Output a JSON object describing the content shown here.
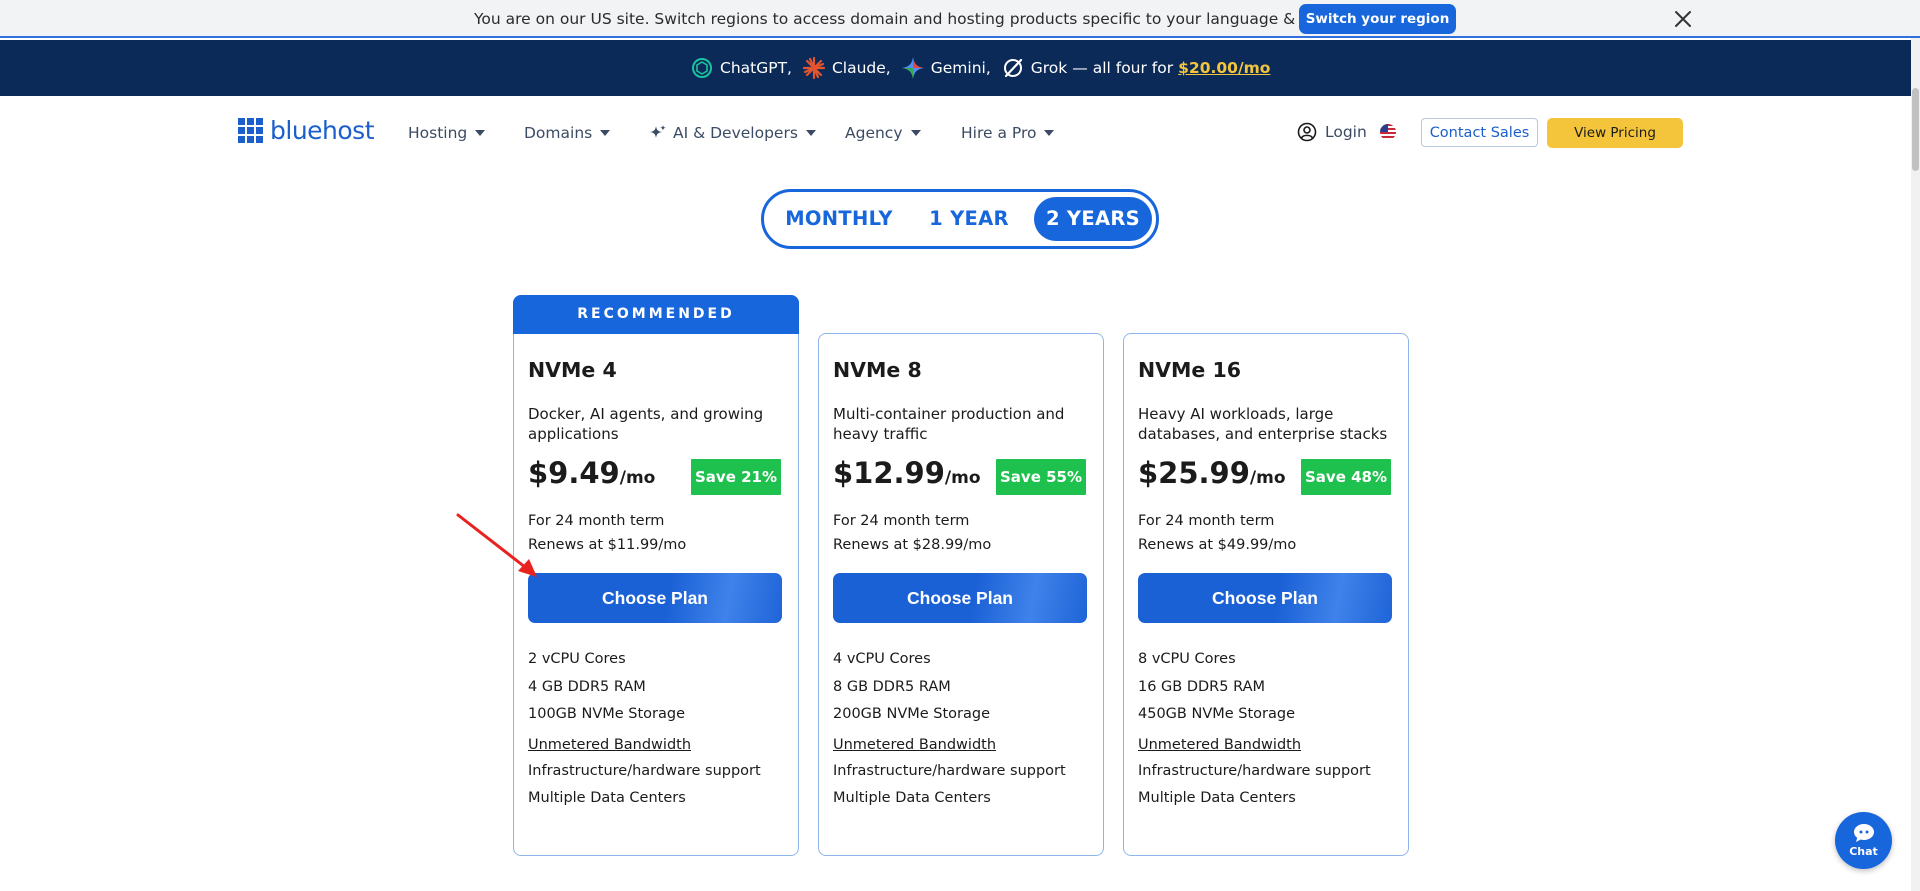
{
  "region_bar": {
    "message": "You are on our US site. Switch regions to access domain and hosting products specific to your language & currency.",
    "switch_button": "Switch your region",
    "close_icon": "close-icon"
  },
  "promo": {
    "items": [
      "ChatGPT,",
      "Claude,",
      "Gemini,",
      "Grok"
    ],
    "suffix": "— all four for",
    "price": "$20.00/mo",
    "icons": [
      "chatgpt-icon",
      "claude-icon",
      "gemini-icon",
      "grok-icon"
    ]
  },
  "nav": {
    "logo": "bluehost",
    "items": [
      {
        "label": "Hosting"
      },
      {
        "label": "Domains"
      },
      {
        "label": "AI & Developers"
      },
      {
        "label": "Agency"
      },
      {
        "label": "Hire a Pro"
      }
    ],
    "login": "Login",
    "contact_sales": "Contact Sales",
    "view_pricing": "View Pricing"
  },
  "term_toggle": {
    "options": [
      "MONTHLY",
      "1 YEAR",
      "2 YEARS"
    ],
    "selected": "2 YEARS"
  },
  "plans": [
    {
      "badge": "RECOMMENDED",
      "name": "NVMe 4",
      "description": "Docker, AI agents, and growing applications",
      "price": "$9.49",
      "per": "/mo",
      "save": "Save 21%",
      "term": "For 24 month term",
      "renews": "Renews at $11.99/mo",
      "cta": "Choose Plan",
      "features": [
        "2 vCPU Cores",
        "4 GB DDR5 RAM",
        "100GB NVMe Storage",
        "Unmetered Bandwidth",
        "Infrastructure/hardware support",
        "Multiple Data Centers"
      ]
    },
    {
      "name": "NVMe 8",
      "description": "Multi-container production and heavy traffic",
      "price": "$12.99",
      "per": "/mo",
      "save": "Save 55%",
      "term": "For 24 month term",
      "renews": "Renews at $28.99/mo",
      "cta": "Choose Plan",
      "features": [
        "4 vCPU Cores",
        "8 GB DDR5 RAM",
        "200GB NVMe Storage",
        "Unmetered Bandwidth",
        "Infrastructure/hardware support",
        "Multiple Data Centers"
      ]
    },
    {
      "name": "NVMe 16",
      "description": "Heavy AI workloads, large databases, and enterprise stacks",
      "price": "$25.99",
      "per": "/mo",
      "save": "Save 48%",
      "term": "For 24 month term",
      "renews": "Renews at $49.99/mo",
      "cta": "Choose Plan",
      "features": [
        "8 vCPU Cores",
        "16 GB DDR5 RAM",
        "450GB NVMe Storage",
        "Unmetered Bandwidth",
        "Infrastructure/hardware support",
        "Multiple Data Centers"
      ]
    }
  ],
  "chat": {
    "label": "Chat"
  },
  "colors": {
    "brand_blue": "#1866dc",
    "navy": "#0c2a57",
    "yellow": "#f4c53b",
    "save_green": "#1ec14e",
    "arrow_red": "#e8231f"
  }
}
